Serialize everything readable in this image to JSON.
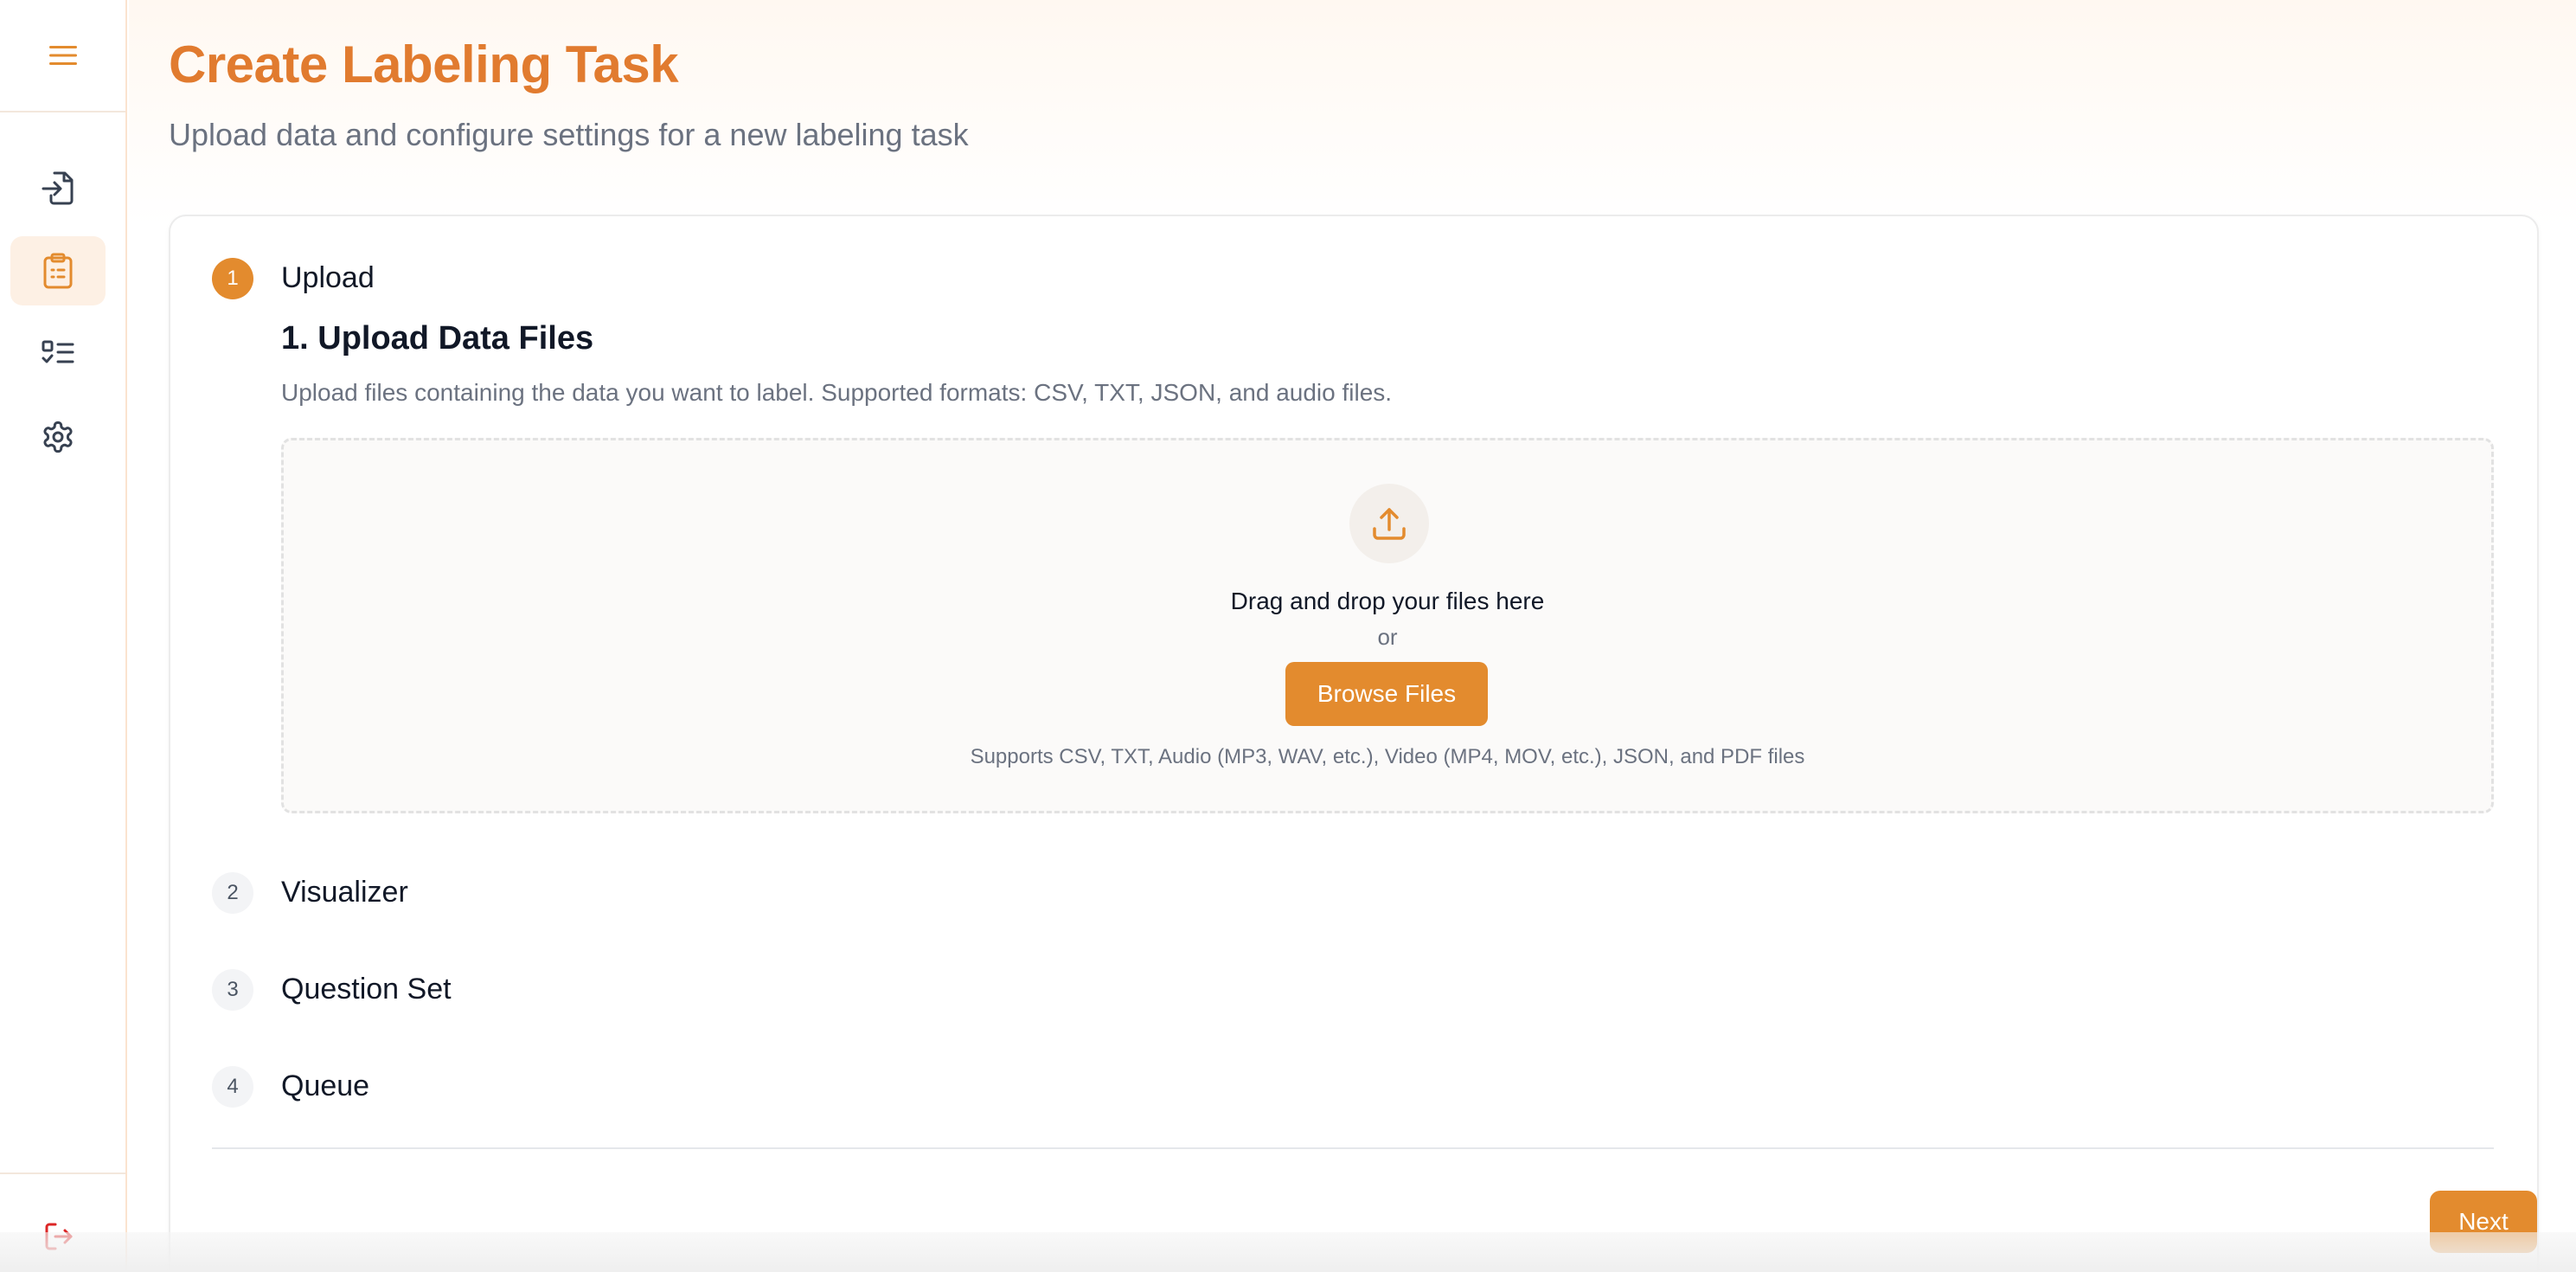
{
  "colors": {
    "accent": "#e38b2e",
    "title": "#e17b2f",
    "logout": "#dc2626"
  },
  "sidebar": {
    "menu_icon": "menu-icon",
    "items": [
      {
        "name": "import-icon",
        "active": false
      },
      {
        "name": "clipboard-icon",
        "active": true
      },
      {
        "name": "task-list-icon",
        "active": false
      },
      {
        "name": "settings-icon",
        "active": false
      }
    ],
    "logout_icon": "logout-icon"
  },
  "header": {
    "title": "Create Labeling Task",
    "subtitle": "Upload data and configure settings for a new labeling task"
  },
  "steps": [
    {
      "number": "1",
      "label": "Upload",
      "active": true
    },
    {
      "number": "2",
      "label": "Visualizer",
      "active": false
    },
    {
      "number": "3",
      "label": "Question Set",
      "active": false
    },
    {
      "number": "4",
      "label": "Queue",
      "active": false
    }
  ],
  "upload_section": {
    "title": "1. Upload Data Files",
    "description": "Upload files containing the data you want to label. Supported formats: CSV, TXT, JSON, and audio files.",
    "drop_text": "Drag and drop your files here",
    "or_text": "or",
    "browse_label": "Browse Files",
    "supports_text": "Supports CSV, TXT, Audio (MP3, WAV, etc.), Video (MP4, MOV, etc.), JSON, and PDF files"
  },
  "footer": {
    "next_label": "Next"
  }
}
